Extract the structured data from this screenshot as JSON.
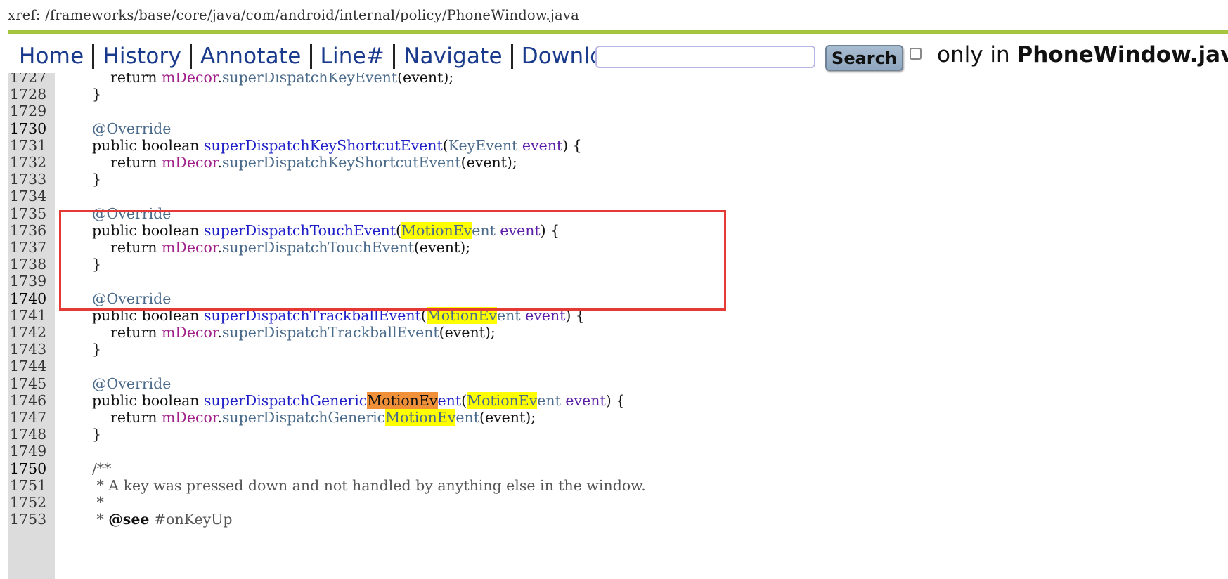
{
  "xref": {
    "prefix": "xref:",
    "path": "/frameworks/base/core/java/com/android/internal/policy/PhoneWindow.java"
  },
  "nav": {
    "home": "Home",
    "history": "History",
    "annotate": "Annotate",
    "line": "Line#",
    "navigate": "Navigate",
    "download": "Download"
  },
  "search": {
    "value": "",
    "button": "Search",
    "only_in": "only in",
    "filename": "PhoneWindow.java"
  },
  "code": {
    "lines": [
      {
        "n": "1727",
        "text": "        return mDecor.superDispatchKeyEvent(event);"
      },
      {
        "n": "1728",
        "text": "    }"
      },
      {
        "n": "1729",
        "text": ""
      },
      {
        "n": "1730",
        "text": "    @Override"
      },
      {
        "n": "1731",
        "text": "    public boolean superDispatchKeyShortcutEvent(KeyEvent event) {"
      },
      {
        "n": "1732",
        "text": "        return mDecor.superDispatchKeyShortcutEvent(event);"
      },
      {
        "n": "1733",
        "text": "    }"
      },
      {
        "n": "1734",
        "text": ""
      },
      {
        "n": "1735",
        "text": "    @Override"
      },
      {
        "n": "1736",
        "text": "    public boolean superDispatchTouchEvent(MotionEvent event) {"
      },
      {
        "n": "1737",
        "text": "        return mDecor.superDispatchTouchEvent(event);"
      },
      {
        "n": "1738",
        "text": "    }"
      },
      {
        "n": "1739",
        "text": ""
      },
      {
        "n": "1740",
        "text": "    @Override"
      },
      {
        "n": "1741",
        "text": "    public boolean superDispatchTrackballEvent(MotionEvent event) {"
      },
      {
        "n": "1742",
        "text": "        return mDecor.superDispatchTrackballEvent(event);"
      },
      {
        "n": "1743",
        "text": "    }"
      },
      {
        "n": "1744",
        "text": ""
      },
      {
        "n": "1745",
        "text": "    @Override"
      },
      {
        "n": "1746",
        "text": "    public boolean superDispatchGenericMotionEvent(MotionEvent event) {"
      },
      {
        "n": "1747",
        "text": "        return mDecor.superDispatchGenericMotionEvent(event);"
      },
      {
        "n": "1748",
        "text": "    }"
      },
      {
        "n": "1749",
        "text": ""
      },
      {
        "n": "1750",
        "text": "    /**"
      },
      {
        "n": "1751",
        "text": "     * A key was pressed down and not handled by anything else in the window."
      },
      {
        "n": "1752",
        "text": "     *"
      },
      {
        "n": "1753",
        "text": "     * @see #onKeyUp"
      }
    ]
  },
  "colors": {
    "accent_bar": "#a5c53d",
    "link": "#1a3a8c",
    "highlight": "#ffff00",
    "current_highlight": "#f0913a",
    "annotation_box": "#e53935"
  }
}
